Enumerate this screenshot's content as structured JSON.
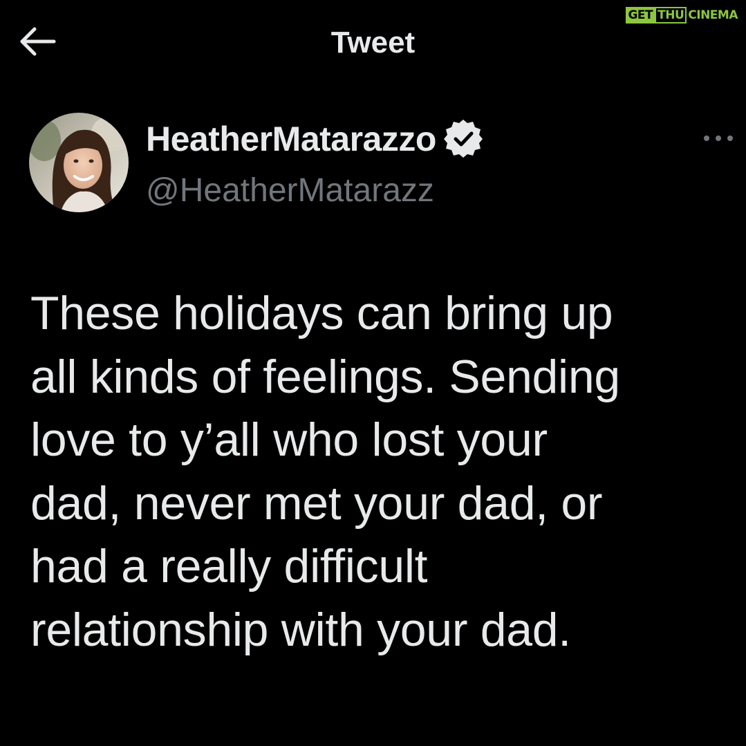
{
  "watermark": {
    "part1": "GET",
    "part2": "THU",
    "part3": "CINEMA"
  },
  "header": {
    "title": "Tweet",
    "back_icon": "arrow-left-icon"
  },
  "author": {
    "display_name": "HeatherMatarazzo",
    "handle": "@HeatherMatarazz",
    "verified": true,
    "verified_icon": "verified-badge-icon",
    "more_icon": "more-dots-icon"
  },
  "tweet": {
    "lines": [
      "These holidays can bring up",
      "all kinds of feelings. Sending",
      "love to y’all who lost your",
      "dad, never met your dad, or",
      "had a really difficult",
      "relationship with your dad."
    ]
  },
  "colors": {
    "background": "#000000",
    "primary_text": "#e7e9ea",
    "secondary_text": "#71767b",
    "watermark_green": "#8cc63f"
  }
}
